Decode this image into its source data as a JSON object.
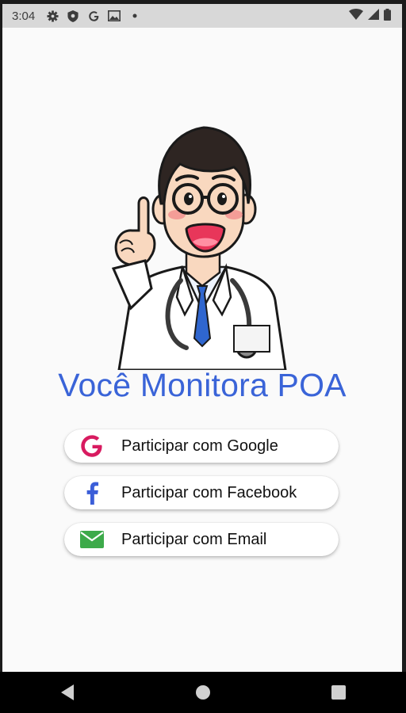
{
  "status_bar": {
    "time": "3:04",
    "icons": [
      "settings-icon",
      "shield-icon",
      "google-icon",
      "image-icon",
      "dot-icon",
      "wifi-icon",
      "signal-icon",
      "battery-icon"
    ]
  },
  "app": {
    "title": "Você Monitora POA",
    "title_color": "#3a64d8"
  },
  "buttons": [
    {
      "label": "Participar com Google",
      "icon": "google-icon",
      "icon_color": "#d81b60"
    },
    {
      "label": "Participar com Facebook",
      "icon": "facebook-icon",
      "icon_color": "#3b5ed8"
    },
    {
      "label": "Participar com Email",
      "icon": "email-icon",
      "icon_color": "#3daa4a"
    }
  ],
  "nav": {
    "icons": [
      "back-icon",
      "home-icon",
      "recents-icon"
    ]
  }
}
